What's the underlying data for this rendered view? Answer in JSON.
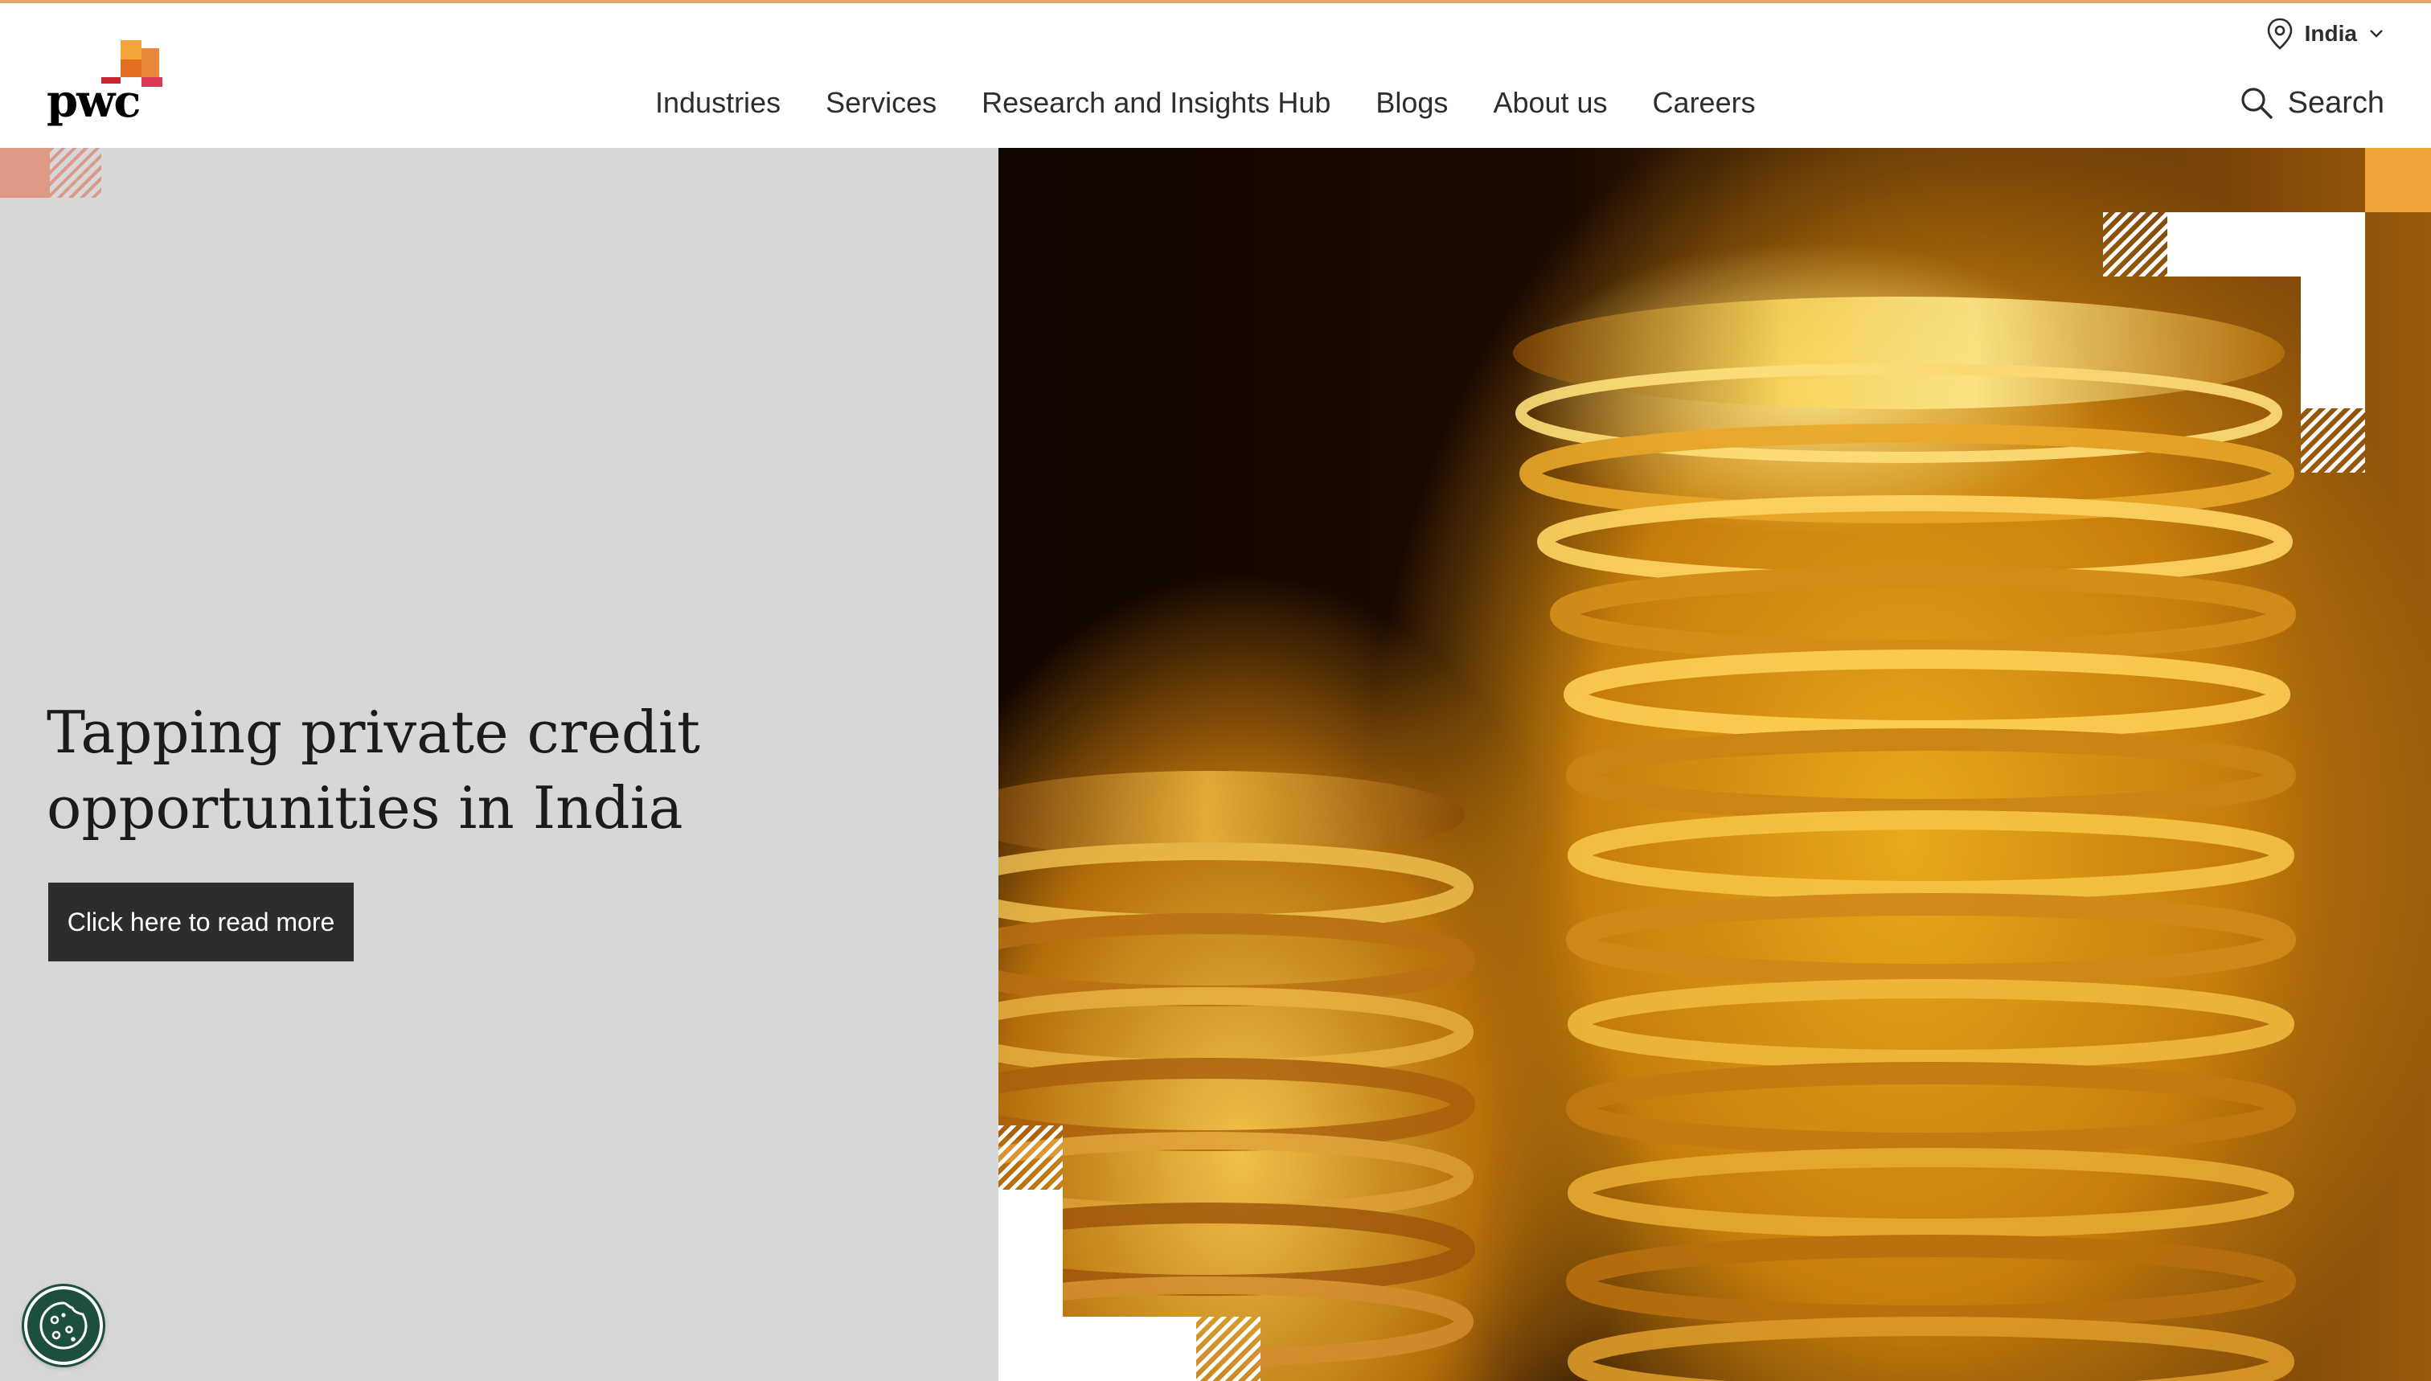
{
  "header": {
    "logo_text": "pwc",
    "nav": [
      {
        "label": "Industries"
      },
      {
        "label": "Services"
      },
      {
        "label": "Research and Insights Hub"
      },
      {
        "label": "Blogs"
      },
      {
        "label": "About us"
      },
      {
        "label": "Careers"
      }
    ],
    "territory": {
      "label": "India",
      "icon": "location-pin-icon"
    },
    "search": {
      "label": "Search",
      "icon": "search-icon"
    }
  },
  "hero": {
    "headline": "Tapping private credit opportunities in India",
    "cta_label": "Click here to read more",
    "image": "stacked-gold-coins"
  },
  "cookie_button": {
    "icon": "cookie-icon"
  },
  "colors": {
    "accent_orange": "#e8a56a",
    "hero_panel": "#d7d7d7",
    "cta_bg": "#2d2d2d",
    "cookie_bg": "#1d4f3f"
  }
}
